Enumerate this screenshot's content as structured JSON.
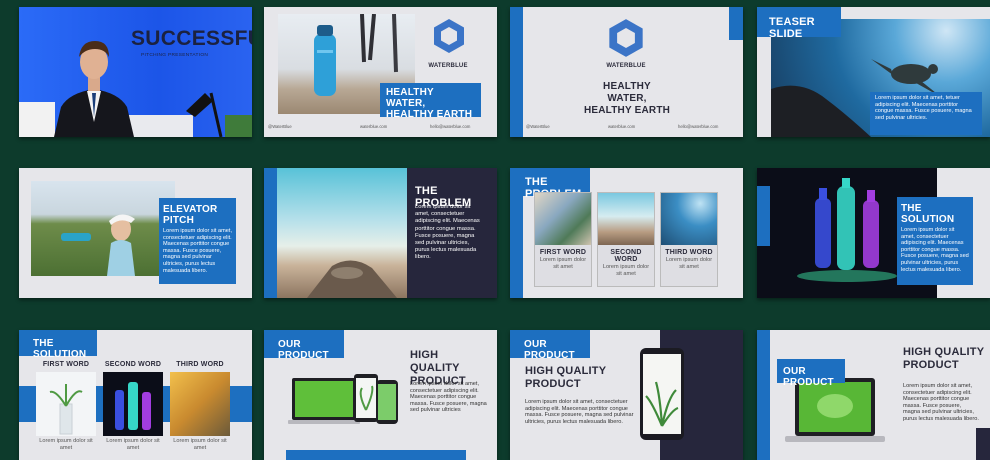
{
  "brand": {
    "name": "WATERBLUE",
    "handle": "@WaterBlue",
    "website": "waterblue.com",
    "email": "hello@waterblue.com"
  },
  "colors": {
    "background": "#0d3b2c",
    "accent": "#1d6fc0",
    "navy": "#26263c",
    "slide_bg": "#e6e6ea"
  },
  "lorem_long": "Lorem ipsum dolor sit amet, consectetuer adipiscing elit. Maecenas porttitor congue massa. Fusce posuere, magna sed pulvinar ultricies, purus lectus malesuada libero.",
  "lorem_short": "Lorem ipsum dolor sit amet",
  "slides": [
    {
      "title": "SUCCESSFUL",
      "subtitle": "PITCHING PRESENTATION"
    },
    {
      "title": "HEALTHY WATER, HEALTHY EARTH"
    },
    {
      "title": "HEALTHY WATER, HEALTHY EARTH"
    },
    {
      "title": "TEASER SLIDE",
      "body": "Lorem ipsum dolor sit amet, tetuer adipiscing elit. Maecenas porttitor congue massa. Fusce posuere, magna sed pulvinar ultricies."
    },
    {
      "title": "ELEVATOR PITCH",
      "body": "Lorem ipsum dolor sit amet, consectetuer adipiscing elit. Maecenas porttitor congue massa. Fusce posuere, magna sed pulvinar ultricies, purus lectus malesuada libero."
    },
    {
      "title": "THE PROBLEM",
      "body": "Lorem ipsum dolor sit amet, consectetuer adipiscing elit. Maecenas porttitor congue massa. Fusce posuere, magna sed pulvinar ultricies, purus lectus malesuada libero."
    },
    {
      "title": "THE PROBLEM",
      "words": [
        "FIRST WORD",
        "SECOND WORD",
        "THIRD WORD"
      ],
      "item_text": "Lorem ipsum dolor sit amet"
    },
    {
      "title": "THE SOLUTION",
      "body": "Lorem ipsum dolor sit amet, consectetuer adipiscing elit. Maecenas porttitor congue massa. Fusce posuere, magna sed pulvinar ultricies, purus lectus malesuada libero."
    },
    {
      "title": "THE SOLUTION",
      "words": [
        "FIRST WORD",
        "SECOND WORD",
        "THIRD WORD"
      ],
      "item_text": "Lorem ipsum dolor sit amet"
    },
    {
      "title": "OUR PRODUCT",
      "heading": "HIGH QUALITY PRODUCT",
      "body": "Lorem ipsum dolor sit amet, consectetuer adipiscing elit. Maecenas porttitor congue massa. Fusce posuere, magna sed pulvinar ultricies"
    },
    {
      "title": "OUR PRODUCT",
      "heading": "HIGH QUALITY PRODUCT",
      "body": "Lorem ipsum dolor sit amet, consectetuer adipiscing elit. Maecenas porttitor congue massa. Fusce posuere, magna sed pulvinar ultricies, purus lectus malesuada libero."
    },
    {
      "title": "OUR PRODUCT",
      "heading": "HIGH QUALITY PRODUCT",
      "body": "Lorem ipsum dolor sit amet, consectetuer adipiscing elit. Maecenas porttitor congue massa. Fusce posuere, magna sed pulvinar ultricies, purus lectus malesuada libero."
    }
  ]
}
